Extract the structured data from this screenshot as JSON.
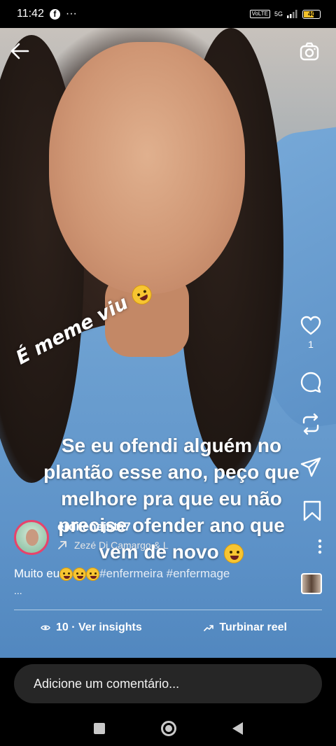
{
  "status_bar": {
    "time": "11:42",
    "app_icon": "facebook-icon",
    "more_dots": "···",
    "volte": "VoLTE",
    "network": "5G",
    "battery": "40"
  },
  "header": {
    "back_icon": "back-arrow-icon",
    "camera_icon": "camera-icon"
  },
  "sticker": {
    "text": "É meme viu"
  },
  "overlay_caption": {
    "lines": [
      "Se eu ofendi alguém no",
      "plantão esse ano, peço que",
      "melhore  pra que eu não",
      "precise ofender ano que",
      "vem de novo"
    ]
  },
  "actions": {
    "like_count": "1",
    "like_icon": "heart-icon",
    "comment_icon": "comment-icon",
    "share_icon": "repost-icon",
    "send_icon": "send-icon",
    "save_icon": "bookmark-icon",
    "more_icon": "more-vertical-icon"
  },
  "author": {
    "username": "erdilenejota7",
    "audio": "Zezé Di Camargo & L"
  },
  "description": {
    "prefix": "Muito eu",
    "hashtags": "#enfermeira #enfermage",
    "more": "..."
  },
  "stats": {
    "insights_label": "10 · Ver insights",
    "boost_label": "Turbinar reel"
  },
  "comment": {
    "placeholder": "Adicione um comentário..."
  },
  "colors": {
    "avatar_ring": "#e8426b",
    "input_bg": "#262626",
    "battery": "#f3c22a"
  }
}
